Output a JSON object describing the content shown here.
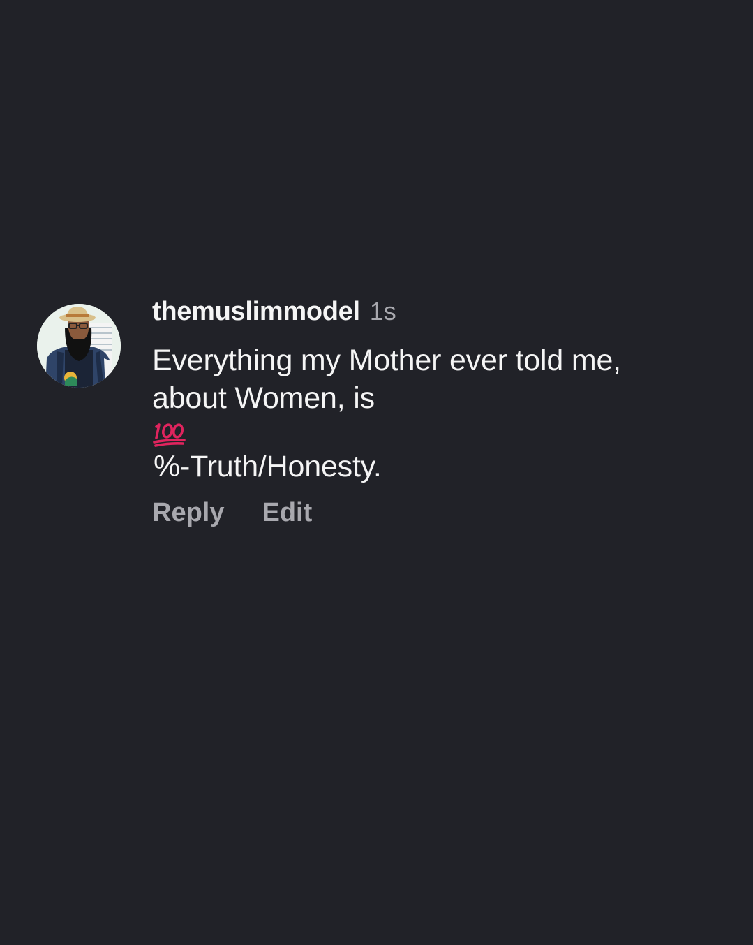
{
  "comment": {
    "username": "themuslimmodel",
    "timestamp": "1s",
    "text_line1": "Everything my Mother ever told me,",
    "text_line2_before_emoji": "about Women, is ",
    "emoji_icon": "hundred-points-icon",
    "text_line2_after_emoji": "%-Truth/Honesty.",
    "actions": {
      "reply_label": "Reply",
      "edit_label": "Edit"
    }
  },
  "colors": {
    "background": "#212228",
    "primary_text": "#f5f5f5",
    "secondary_text": "#a8a8ae",
    "emoji_red": "#e0245e"
  }
}
